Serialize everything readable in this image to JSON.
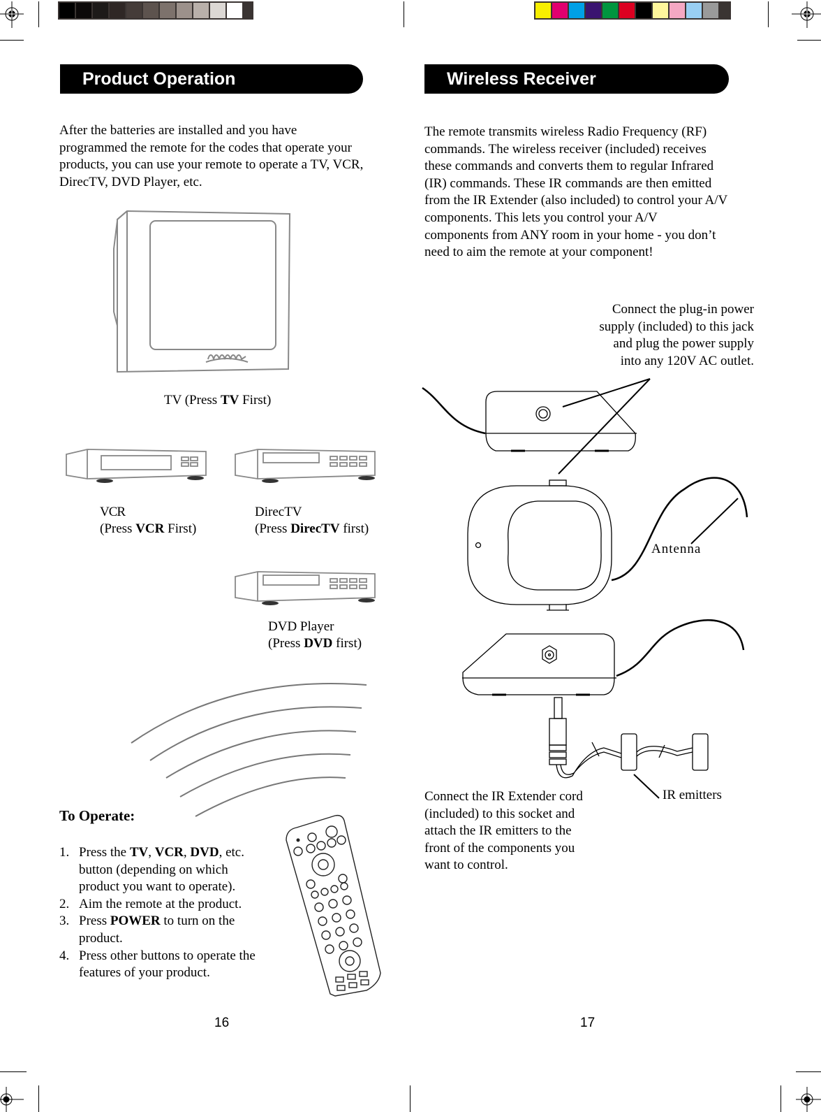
{
  "color_bars": {
    "grayscale": [
      "#000000",
      "#0c0909",
      "#1d1a19",
      "#2f2725",
      "#453c39",
      "#5d534e",
      "#7d726c",
      "#9c918b",
      "#b9b0aa",
      "#dcd8d4",
      "#ffffff"
    ],
    "process": [
      "#f7ef00",
      "#e1006f",
      "#00a0e6",
      "#3a1370",
      "#00953f",
      "#dc0021",
      "#000000",
      "#fff69c",
      "#f5a8c3",
      "#99cff3",
      "#9a9a9a"
    ]
  },
  "left_page": {
    "header": "Product Operation",
    "intro": "After the batteries are installed and you have programmed the remote for the codes that operate your products, you can use your remote to operate a TV, VCR, DirecTV, DVD Player, etc.",
    "intro_lines": [
      "After the batteries are installed and you have",
      "programmed the remote for the codes that operate your",
      "products, you can use your remote to operate a TV, VCR,",
      "DirecTV, DVD Player, etc."
    ],
    "devices": {
      "tv": {
        "pre": "TV (Press ",
        "key": "TV",
        "post": " First)"
      },
      "vcr": {
        "name": "VCR",
        "pre": "(Press ",
        "key": "VCR",
        "post": " First)"
      },
      "directv": {
        "name": "DirecTV",
        "pre": "(Press ",
        "key": "DirecTV",
        "post": " first)"
      },
      "dvd": {
        "name": "DVD Player",
        "pre": "(Press ",
        "key": "DVD",
        "post": " first)"
      }
    },
    "to_operate": {
      "title": "To  Operate:",
      "steps": [
        {
          "num": "1.",
          "parts": [
            {
              "t": "Press the ",
              "b": false
            },
            {
              "t": "TV",
              "b": true
            },
            {
              "t": ", ",
              "b": false
            },
            {
              "t": "VCR",
              "b": true
            },
            {
              "t": ", ",
              "b": false
            },
            {
              "t": "DVD",
              "b": true
            },
            {
              "t": ", etc. button (depending on which product you want to operate).",
              "b": false
            }
          ]
        },
        {
          "num": "2.",
          "parts": [
            {
              "t": "Aim the remote at the product.",
              "b": false
            }
          ]
        },
        {
          "num": "3.",
          "parts": [
            {
              "t": "Press ",
              "b": false
            },
            {
              "t": "POWER",
              "b": true
            },
            {
              "t": " to turn on the product.",
              "b": false
            }
          ]
        },
        {
          "num": "4.",
          "parts": [
            {
              "t": "Press other buttons to operate the features of your product.",
              "b": false
            }
          ]
        }
      ]
    },
    "page_number": "16"
  },
  "right_page": {
    "header": "Wireless Receiver",
    "intro_lines": [
      "The remote transmits wireless Radio Frequency (RF)",
      "commands. The wireless receiver (included) receives",
      "these commands and converts them to regular Infrared",
      "(IR) commands. These IR commands are then emitted",
      "from the IR Extender (also included) to control your A/V",
      "components. This lets you control your A/V",
      "components from ANY room in your home - you don’t",
      "need to aim the remote at your component!"
    ],
    "power_note_lines": [
      "Connect the plug-in power",
      "supply (included) to this jack",
      "and plug the power supply",
      "into any 120V AC outlet."
    ],
    "antenna_label": "Antenna",
    "ir_emitters_label": "IR emitters",
    "ir_note_lines": [
      "Connect the IR Extender cord",
      "(included) to this socket and",
      "attach the IR emitters to the",
      "front of the components you",
      "want to control."
    ],
    "page_number": "17"
  }
}
